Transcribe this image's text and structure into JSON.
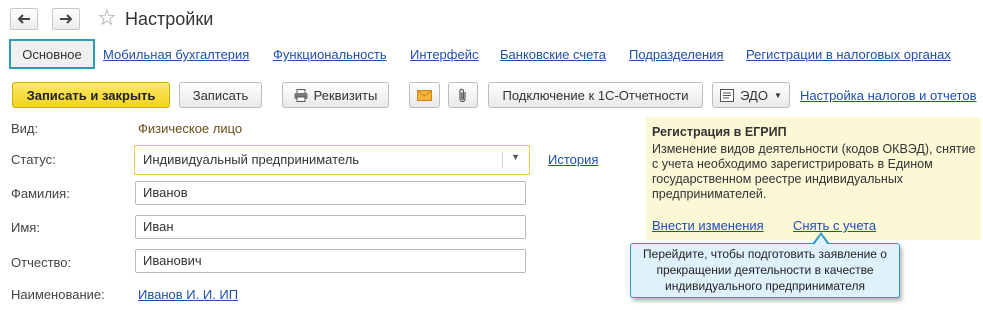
{
  "header": {
    "back_icon": "arrow-left-icon",
    "forward_icon": "arrow-right-icon",
    "favorite_icon": "star-icon",
    "title": "Настройки"
  },
  "tabs": {
    "active": "Основное",
    "items": [
      "Мобильная бухгалтерия",
      "Функциональность",
      "Интерфейс",
      "Банковские счета",
      "Подразделения",
      "Регистрации в налоговых органах"
    ]
  },
  "toolbar": {
    "save_close": "Записать и закрыть",
    "save": "Записать",
    "requisites": "Реквизиты",
    "mail_icon": "envelope-icon",
    "attach_icon": "paperclip-icon",
    "connect": "Подключение к 1С-Отчетности",
    "edo": "ЭДО",
    "tax_settings": "Настройка налогов и отчетов"
  },
  "form": {
    "type_label": "Вид:",
    "type_value": "Физическое лицо",
    "status_label": "Статус:",
    "status_value": "Индивидуальный предприниматель",
    "history_link": "История",
    "surname_label": "Фамилия:",
    "surname_value": "Иванов",
    "name_label": "Имя:",
    "name_value": "Иван",
    "patronymic_label": "Отчество:",
    "patronymic_value": "Иванович",
    "fullname_label": "Наименование:",
    "fullname_value": "Иванов И. И. ИП"
  },
  "panel": {
    "title": "Регистрация в ЕГРИП",
    "text": "Изменение видов деятельности (кодов ОКВЭД), снятие с учета необходимо зарегистрировать в Едином государственном реестре индивидуальных предпринимателей.",
    "link_change": "Внести изменения",
    "link_deregister": "Снять с учета"
  },
  "tooltip": {
    "text": "Перейдите, чтобы подготовить заявление о прекращении деятельности в качестве индивидуального предпринимателя"
  },
  "colors": {
    "accent_border": "#2e9bb0",
    "primary_button": "#f3d321",
    "link": "#1f4fa8",
    "panel_bg": "#fbf8d6",
    "tooltip_bg": "#dff1fb",
    "tooltip_border": "#2c9ac6"
  }
}
